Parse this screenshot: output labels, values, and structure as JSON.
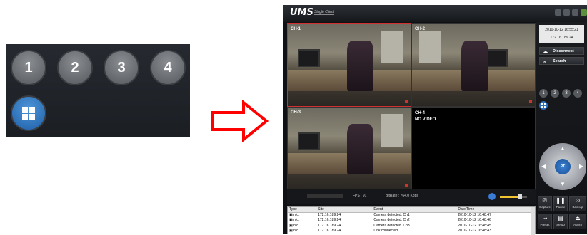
{
  "zoom": {
    "buttons": [
      "1",
      "2",
      "3",
      "4"
    ]
  },
  "app": {
    "title": "UMS",
    "subtitle": "Single Client"
  },
  "channels": [
    {
      "label": "CH-1",
      "selected": true
    },
    {
      "label": "CH-2",
      "selected": false
    },
    {
      "label": "CH-3",
      "selected": false
    },
    {
      "label": "CH-4",
      "novideo": "NO VIDEO"
    }
  ],
  "status": {
    "fps": "FPS : 91",
    "bitrate": "BitRate : 764.0 Kbps"
  },
  "log": {
    "headers": [
      "Type",
      "Site",
      "Event",
      "Date/Time"
    ],
    "rows": [
      [
        "Info.",
        "172.16.189.24",
        "Camera detected. Ch1",
        "2010-10-12 16:48:47"
      ],
      [
        "Info.",
        "172.16.189.24",
        "Camera detected. Ch2",
        "2010-10-12 16:48:46"
      ],
      [
        "Info.",
        "172.16.189.24",
        "Camera detected. Ch3",
        "2010-10-12 16:48:45"
      ],
      [
        "Info.",
        "172.16.189.24",
        "Link connected.",
        "2010-10-12 16:48:43"
      ]
    ]
  },
  "side": {
    "datetime": "2010-10-12 16:55:21",
    "ip": "172.16.189.24",
    "disconnect": "Disconnect",
    "search": "Search",
    "split_buttons": [
      "1",
      "2",
      "3",
      "4"
    ],
    "ptz_label": "PT",
    "tools": [
      "Capture",
      "Pause",
      "Backup",
      "Preset",
      "Setup",
      "Alarm"
    ]
  },
  "colors": {
    "accent": "#2b6fc0",
    "selected_border": "#d03030",
    "arrow": "#ff0000"
  }
}
